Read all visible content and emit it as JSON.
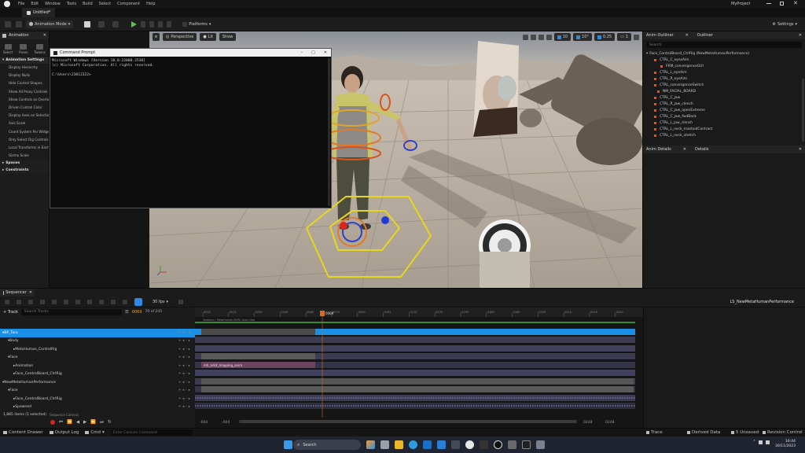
{
  "menu": {
    "items": [
      "File",
      "Edit",
      "Window",
      "Tools",
      "Build",
      "Select",
      "Component",
      "Help"
    ],
    "project": "MyProject"
  },
  "tab": {
    "title": "Untitled*"
  },
  "toolbar": {
    "mode": "Animation Mode",
    "platforms": "Platforms",
    "settings": "Settings"
  },
  "left_panel": {
    "tab": "Animation",
    "tools": [
      "Select",
      "Poses",
      "Tweens"
    ],
    "section": "Animation Settings",
    "items": [
      "Display Hierarchy",
      "Display Nulls",
      "Hide Control Shapes",
      "Show All Proxy Controls",
      "Show Controls as Overlay",
      "Driven Control Color",
      "Display Axes on Selection",
      "Axis Scale",
      "Coord System Per Widget M",
      "Only Select Rig Controls",
      "Local Transforms in Each L",
      "Gizmo Scale"
    ],
    "sections_bottom": [
      "Spaces",
      "Constraints"
    ]
  },
  "viewport": {
    "view_mode": "Perspective",
    "lit": "Lit",
    "show": "Show",
    "grid_snap": "10",
    "rot_snap": "10°",
    "scale_snap": "0.25",
    "camera_speed": "1"
  },
  "cmd": {
    "title": "Command Prompt",
    "lines": [
      "Microsoft Windows [Version 10.0.22000.2538]",
      "(c) Microsoft Corporation. All rights reserved.",
      "",
      "C:\\Users\\23012322>"
    ]
  },
  "outliner": {
    "tabs": [
      "Anim Outliner",
      "Outliner"
    ],
    "search_placeholder": "Search",
    "root": "Face_ControlBoard_CtrlRig (NewMetaHumanPerformance)",
    "items": [
      "CTRL_C_eyesAim",
      "FRM_convergenceGUI",
      "CTRL_L_eyeAim",
      "CTRL_R_eyeAim",
      "CTRL_convergenceSwitch",
      "NM_FACIAL_BOARD",
      "CTRL_C_jaw",
      "CTRL_R_jaw_clench",
      "CTRL_C_jaw_openExtreme",
      "CTRL_C_jaw_fwdBack",
      "CTRL_L_jaw_clench",
      "CTRL_L_neck_mastoidContract",
      "CTRL_L_neck_stretch"
    ]
  },
  "details": {
    "tabs": [
      "Anim Details",
      "Details"
    ]
  },
  "sequencer": {
    "tab": "Sequencer",
    "fps": "30 fps",
    "sequence_name": "LS_NewMetaHumanPerformance",
    "add_track": "+ Track",
    "search_placeholder": "Search Tracks",
    "current_frame": "0069",
    "frame_counter": "70 of 245",
    "playhead": "0069",
    "tracks": [
      {
        "label": "BP_Taro",
        "indent": 0,
        "selected": true
      },
      {
        "label": "Body",
        "indent": 1
      },
      {
        "label": "MetaHuman_ControlRig",
        "indent": 2
      },
      {
        "label": "Face",
        "indent": 1
      },
      {
        "label": "Animation",
        "indent": 2
      },
      {
        "label": "Face_ControlBoard_CtrlRig",
        "indent": 2
      },
      {
        "label": "NewMetaHumanPerformance",
        "indent": 0
      },
      {
        "label": "Face",
        "indent": 1
      },
      {
        "label": "Face_ControlBoard_CtrlRig",
        "indent": 2
      },
      {
        "label": "Spawned",
        "indent": 2
      }
    ],
    "items_count": "1,885 items (1 selected)",
    "sequence_camera": "Sequence Camera",
    "clip_anim": "mh_arkit_mapping_anim",
    "clip_top": "Skeleton | MetaHuman RCRC Anim Seq",
    "ticks": [
      "0000",
      "0015",
      "0030",
      "0045",
      "0060",
      "0075",
      "0090",
      "0105",
      "0120",
      "0135",
      "0150",
      "0165",
      "0180",
      "0195",
      "0210",
      "0225",
      "0240"
    ],
    "range_start": "-004",
    "range_start2": "-004",
    "range_end": "0248",
    "range_end2": "0248"
  },
  "status": {
    "content_drawer": "Content Drawer",
    "output_log": "Output Log",
    "cmd": "Cmd",
    "console_placeholder": "Enter Console Command",
    "trace": "Trace",
    "derived": "Derived Data",
    "unsaved": "5 Unsaved",
    "revision": "Revision Control"
  },
  "taskbar": {
    "search": "Search",
    "time": "16:44",
    "date": "30/11/2023"
  }
}
